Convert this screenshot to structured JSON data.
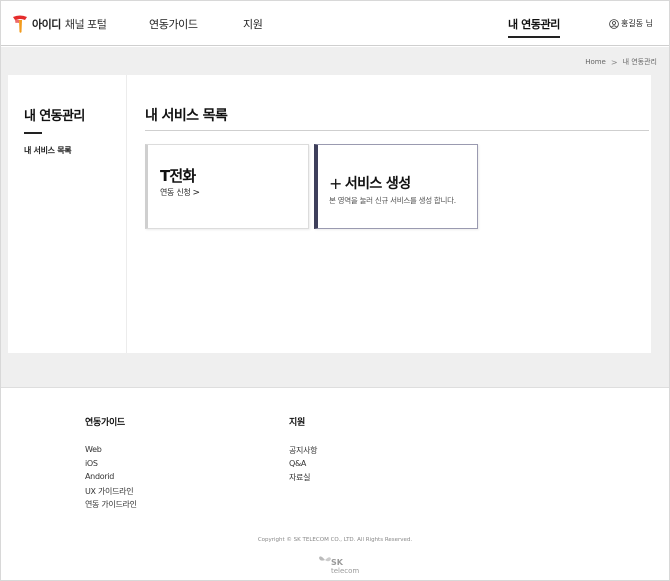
{
  "header": {
    "logo_name": "아이디",
    "logo_sub": "채널 포털",
    "nav": [
      "연동가이드",
      "지원"
    ],
    "active_nav": "내 연동관리",
    "user": "홍길동 님"
  },
  "breadcrumb": {
    "home": "Home",
    "sep": ">",
    "current": "내 연동관리"
  },
  "sidebar": {
    "title": "내 연동관리",
    "item": "내 서비스 목록"
  },
  "main": {
    "title": "내 서비스 목록",
    "service_card": {
      "name": "T전화",
      "link": "연동 신청",
      "arrow": ">"
    },
    "new_card": {
      "plus": "+",
      "title": "서비스 생성",
      "desc": "본 영역을 눌러 신규 서비스를 생성 합니다."
    }
  },
  "footer": {
    "guide": {
      "title": "연동가이드",
      "links": [
        "Web",
        "iOS",
        "Andorid",
        "UX 가이드라인",
        "연동 가이드라인"
      ]
    },
    "support": {
      "title": "지원",
      "links": [
        "공지사항",
        "Q&A",
        "자료실"
      ]
    },
    "copyright": "Copyright © SK TELECOM CO., LTD. All Rights Reserved.",
    "sk_logo": {
      "mark": "SK",
      "word": "telecom"
    }
  },
  "colors": {
    "brand_red": "#e52b2b",
    "brand_orange": "#f29b1d",
    "accent_navy": "#3e3f5b",
    "gray_bg": "#efefef"
  }
}
